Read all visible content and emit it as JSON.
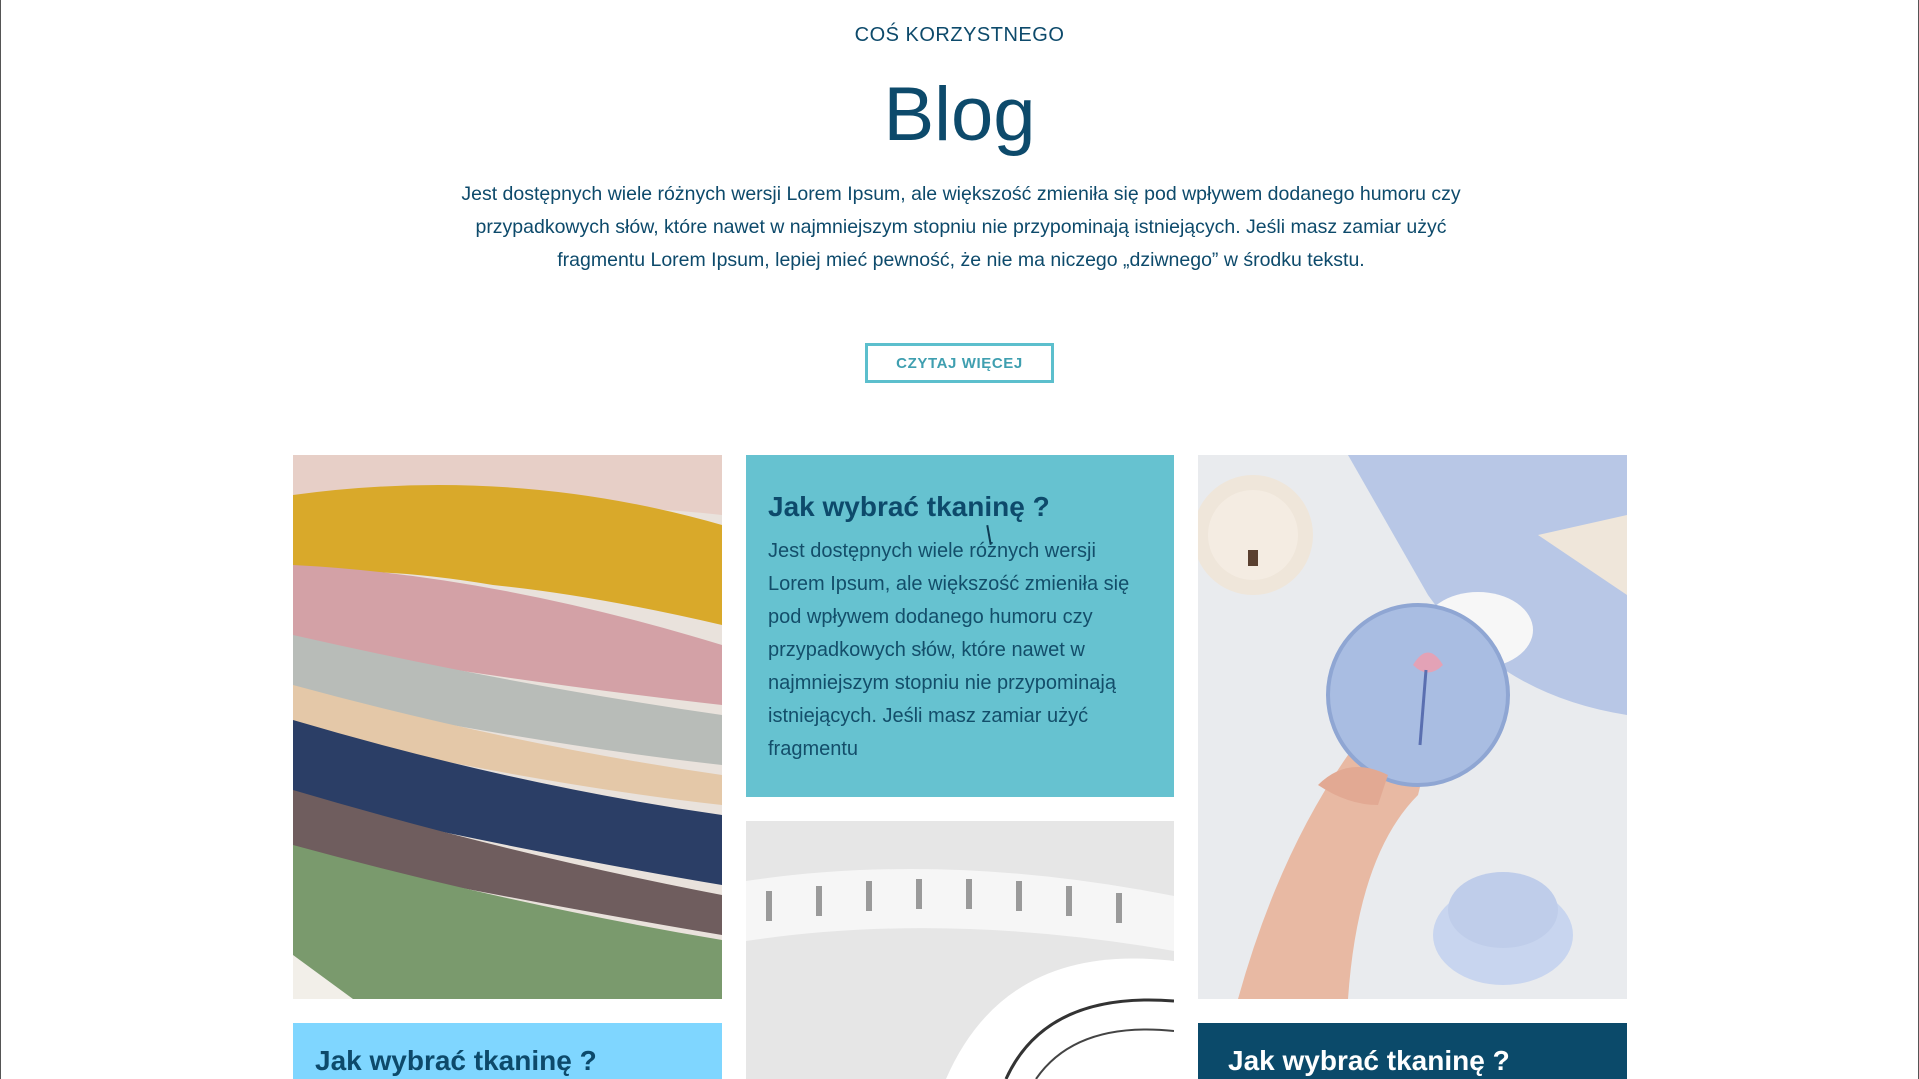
{
  "section": {
    "eyebrow": "COŚ KORZYSTNEGO",
    "title": "Blog",
    "intro": "Jest dostępnych wiele różnych wersji Lorem Ipsum, ale większość zmieniła się pod wpływem dodanego humoru czy przypadkowych słów, które nawet w najmniejszym stopniu nie przypominają istniejących. Jeśli masz zamiar użyć fragmentu Lorem Ipsum, lepiej mieć pewność, że nie ma niczego „dziwnego” w środku tekstu.",
    "more_button": "CZYTAJ WIĘCEJ"
  },
  "cards": {
    "featured": {
      "title": "Jak wybrać tkaninę ?",
      "body": "Jest dostępnych wiele różnych wersji Lorem Ipsum, ale większość zmieniła się pod wpływem dodanego humoru czy przypadkowych słów, które nawet w najmniejszym stopniu nie przypominają istniejących. Jeśli masz zamiar użyć fragmentu"
    },
    "left_strip": {
      "title": "Jak wybrać tkaninę ?"
    },
    "right_strip": {
      "title": "Jak wybrać tkaninę ?"
    }
  },
  "colors": {
    "brand": "#0d4a6b",
    "accent": "#66c2d0",
    "button_border": "#5cbfcd",
    "light_strip": "#7fd6ff",
    "dark_strip": "#0b4a6a"
  }
}
